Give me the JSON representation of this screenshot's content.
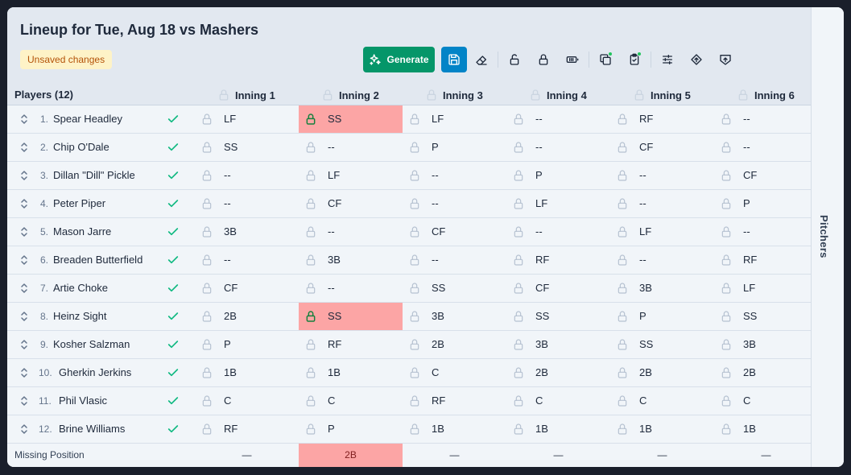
{
  "header": {
    "title": "Lineup for Tue, Aug 18 vs Mashers",
    "status_badge": "Unsaved changes",
    "generate_label": "Generate"
  },
  "sidebar": {
    "label": "Pitchers"
  },
  "columns": {
    "players_label": "Players (12)",
    "innings": [
      "Inning 1",
      "Inning 2",
      "Inning 3",
      "Inning 4",
      "Inning 5",
      "Inning 6"
    ]
  },
  "players": [
    {
      "num": "1.",
      "name": "Spear Headley",
      "positions": [
        "LF",
        "SS",
        "LF",
        "--",
        "RF",
        "--"
      ],
      "locked": [
        false,
        true,
        false,
        false,
        false,
        false
      ],
      "error": [
        false,
        true,
        false,
        false,
        false,
        false
      ]
    },
    {
      "num": "2.",
      "name": "Chip O'Dale",
      "positions": [
        "SS",
        "--",
        "P",
        "--",
        "CF",
        "--"
      ],
      "locked": [
        false,
        false,
        false,
        false,
        false,
        false
      ],
      "error": [
        false,
        false,
        false,
        false,
        false,
        false
      ]
    },
    {
      "num": "3.",
      "name": "Dillan \"Dill\" Pickle",
      "positions": [
        "--",
        "LF",
        "--",
        "P",
        "--",
        "CF"
      ],
      "locked": [
        false,
        false,
        false,
        false,
        false,
        false
      ],
      "error": [
        false,
        false,
        false,
        false,
        false,
        false
      ]
    },
    {
      "num": "4.",
      "name": "Peter Piper",
      "positions": [
        "--",
        "CF",
        "--",
        "LF",
        "--",
        "P"
      ],
      "locked": [
        false,
        false,
        false,
        false,
        false,
        false
      ],
      "error": [
        false,
        false,
        false,
        false,
        false,
        false
      ]
    },
    {
      "num": "5.",
      "name": "Mason Jarre",
      "positions": [
        "3B",
        "--",
        "CF",
        "--",
        "LF",
        "--"
      ],
      "locked": [
        false,
        false,
        false,
        false,
        false,
        false
      ],
      "error": [
        false,
        false,
        false,
        false,
        false,
        false
      ]
    },
    {
      "num": "6.",
      "name": "Breaden Butterfield",
      "positions": [
        "--",
        "3B",
        "--",
        "RF",
        "--",
        "RF"
      ],
      "locked": [
        false,
        false,
        false,
        false,
        false,
        false
      ],
      "error": [
        false,
        false,
        false,
        false,
        false,
        false
      ]
    },
    {
      "num": "7.",
      "name": "Artie Choke",
      "positions": [
        "CF",
        "--",
        "SS",
        "CF",
        "3B",
        "LF"
      ],
      "locked": [
        false,
        false,
        false,
        false,
        false,
        false
      ],
      "error": [
        false,
        false,
        false,
        false,
        false,
        false
      ]
    },
    {
      "num": "8.",
      "name": "Heinz Sight",
      "positions": [
        "2B",
        "SS",
        "3B",
        "SS",
        "P",
        "SS"
      ],
      "locked": [
        false,
        true,
        false,
        false,
        false,
        false
      ],
      "error": [
        false,
        true,
        false,
        false,
        false,
        false
      ]
    },
    {
      "num": "9.",
      "name": "Kosher Salzman",
      "positions": [
        "P",
        "RF",
        "2B",
        "3B",
        "SS",
        "3B"
      ],
      "locked": [
        false,
        false,
        false,
        false,
        false,
        false
      ],
      "error": [
        false,
        false,
        false,
        false,
        false,
        false
      ]
    },
    {
      "num": "10.",
      "name": "Gherkin Jerkins",
      "positions": [
        "1B",
        "1B",
        "C",
        "2B",
        "2B",
        "2B"
      ],
      "locked": [
        false,
        false,
        false,
        false,
        false,
        false
      ],
      "error": [
        false,
        false,
        false,
        false,
        false,
        false
      ]
    },
    {
      "num": "11.",
      "name": "Phil Vlasic",
      "positions": [
        "C",
        "C",
        "RF",
        "C",
        "C",
        "C"
      ],
      "locked": [
        false,
        false,
        false,
        false,
        false,
        false
      ],
      "error": [
        false,
        false,
        false,
        false,
        false,
        false
      ]
    },
    {
      "num": "12.",
      "name": "Brine Williams",
      "positions": [
        "RF",
        "P",
        "1B",
        "1B",
        "1B",
        "1B"
      ],
      "locked": [
        false,
        false,
        false,
        false,
        false,
        false
      ],
      "error": [
        false,
        false,
        false,
        false,
        false,
        false
      ]
    }
  ],
  "footer": {
    "label": "Missing Position",
    "values": [
      "—",
      "2B",
      "—",
      "—",
      "—",
      "—"
    ],
    "error": [
      false,
      true,
      false,
      false,
      false,
      false
    ]
  },
  "colors": {
    "primary_green": "#059669",
    "save_blue": "#0284c7",
    "error_bg": "#fca5a5",
    "check_green": "#10b981",
    "badge_bg": "#fef3c7",
    "badge_text": "#b45309"
  },
  "icons": {
    "generate": "sparkles-icon",
    "save": "floppy-disk-icon",
    "clear": "eraser-icon",
    "unlock_all": "lock-open-icon",
    "lock_all": "lock-icon",
    "battery": "battery-icon",
    "copy": "copy-icon",
    "clipboard": "clipboard-check-icon",
    "settings": "sliders-icon",
    "upload": "arrow-up-circle-icon",
    "export": "house-arrow-icon"
  }
}
